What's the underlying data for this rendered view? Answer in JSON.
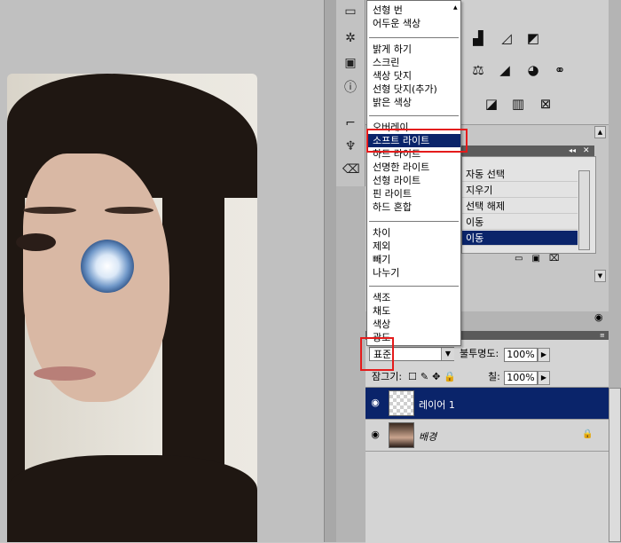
{
  "canvas": {
    "photo_alt": ""
  },
  "blend_menu": {
    "groups": [
      [
        "선형 번",
        "어두운 색상"
      ],
      [
        "밝게 하기",
        "스크린",
        "색상 닷지",
        "선형 닷지(추가)",
        "밝은 색상"
      ],
      [
        "오버레이",
        "소프트 라이트",
        "하드 라이트",
        "선명한 라이트",
        "선형 라이트",
        "핀 라이트",
        "하드 혼합"
      ],
      [
        "차이",
        "제외",
        "빼기",
        "나누기"
      ],
      [
        "색조",
        "채도",
        "색상",
        "광도"
      ]
    ],
    "selected": "소프트 라이트"
  },
  "history": {
    "rows": [
      "자동 선택",
      "지우기",
      "선택 해제",
      "이동",
      "이동"
    ],
    "selected_index": 4
  },
  "layers": {
    "blend_mode": "표준",
    "opacity_label": "불투명도:",
    "opacity_value": "100%",
    "lock_label": "잠그기:",
    "fill_label": "칠:",
    "fill_value": "100%",
    "items": [
      {
        "name": "레이어 1",
        "selected": true
      },
      {
        "name": "배경",
        "selected": false
      }
    ]
  },
  "colors": {
    "selection": "#0a246a",
    "highlight": "#e41b1b"
  }
}
